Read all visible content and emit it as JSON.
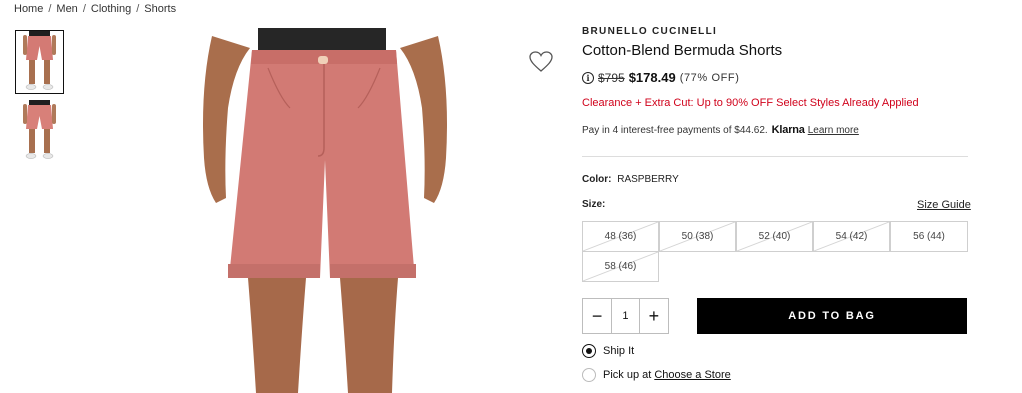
{
  "breadcrumb": {
    "items": [
      "Home",
      "Men",
      "Clothing",
      "Shorts"
    ]
  },
  "product": {
    "brand": "BRUNELLO CUCINELLI",
    "title": "Cotton-Blend Bermuda Shorts",
    "original_price": "$795",
    "sale_price": "$178.49",
    "discount": "(77% OFF)",
    "promo": "Clearance + Extra Cut: Up to 90% OFF Select Styles Already Applied",
    "color_label": "Color:",
    "color_value": "RASPBERRY",
    "accent_color": "#d0021b",
    "swatch_color": "#d47a74"
  },
  "klarna": {
    "text": "Pay in 4 interest-free payments of $44.62.",
    "logo": "Klarna",
    "link": "Learn more"
  },
  "sizes": {
    "label": "Size:",
    "guide": "Size Guide",
    "options": [
      "48 (36)",
      "50 (38)",
      "52 (40)",
      "54 (42)",
      "56 (44)",
      "58 (46)"
    ]
  },
  "quantity": {
    "minus": "−",
    "value": "1",
    "plus": "+"
  },
  "cart": {
    "add_label": "ADD TO BAG"
  },
  "shipping": {
    "ship_label": "Ship It",
    "pickup_label": "Pick up at",
    "store_link": "Choose a Store"
  },
  "icons": {
    "info": "i",
    "heart": "heart-icon"
  }
}
